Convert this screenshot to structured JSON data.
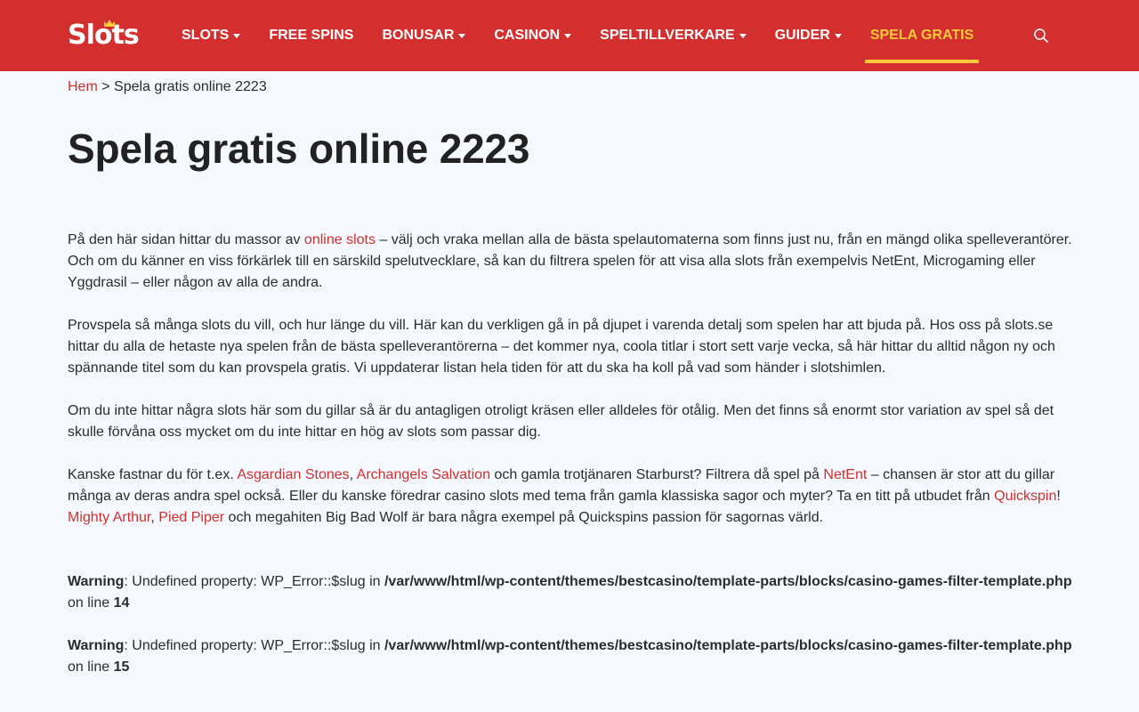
{
  "header": {
    "logo_text": "Slots",
    "nav": [
      {
        "label": "SLOTS",
        "dropdown": true
      },
      {
        "label": "FREE SPINS",
        "dropdown": false
      },
      {
        "label": "BONUSAR",
        "dropdown": true
      },
      {
        "label": "CASINON",
        "dropdown": true
      },
      {
        "label": "SPELTILLVERKARE",
        "dropdown": true
      },
      {
        "label": "GUIDER",
        "dropdown": true
      },
      {
        "label": "SPELA GRATIS",
        "dropdown": false,
        "active": true
      }
    ],
    "search_icon": "search-icon",
    "colors": {
      "brand": "#d32f2f",
      "accent": "#ffc83d"
    }
  },
  "breadcrumb": {
    "home": "Hem",
    "separator": ">",
    "current": "Spela gratis online 2223"
  },
  "page_title": "Spela gratis online 2223",
  "content": {
    "p1": {
      "t1": "På den här sidan hittar du massor av ",
      "link1": "online slots",
      "t2": " – välj och vraka mellan alla de bästa spelautomaterna som finns just nu, från en mängd olika spelleverantörer. Och om du känner en viss förkärlek till en särskild spelutvecklare, så kan du filtrera spelen för att visa alla slots från exempelvis NetEnt, Microgaming eller Yggdrasil – eller någon av alla de andra."
    },
    "p2": "Provspela så många slots du vill, och hur länge du vill. Här kan du verkligen gå in på djupet i varenda detalj som spelen har att bjuda på. Hos oss på slots.se hittar du alla de hetaste nya spelen från de bästa spelleverantörerna – det kommer nya, coola titlar i stort sett varje vecka, så här hittar du alltid någon ny och spännande titel som du kan provspela gratis. Vi uppdaterar listan hela tiden för att du ska ha koll på vad som händer i slotshimlen.",
    "p3": "Om du inte hittar några slots här som du gillar så är du antagligen otroligt kräsen eller alldeles för otålig. Men det finns så enormt stor variation av spel så det skulle förvåna oss mycket om du inte hittar en hög av slots som passar dig.",
    "p4": {
      "t1": "Kanske fastnar du för t.ex. ",
      "link1": "Asgardian Stones",
      "t2": ", ",
      "link2": "Archangels Salvation",
      "t3": " och gamla trotjänaren Starburst? Filtrera då spel på ",
      "link3": "NetEnt",
      "t4": " – chansen är stor att du gillar många av deras andra spel också. Eller du kanske föredrar casino slots med tema från gamla klassiska sagor och myter? Ta en titt på utbudet från ",
      "link4": "Quickspin",
      "t5": "! ",
      "link5": "Mighty Arthur",
      "t6": ", ",
      "link6": "Pied Piper",
      "t7": " och megahiten Big Bad Wolf är bara några exempel på Quickspins passion för sagornas värld."
    }
  },
  "warnings": [
    {
      "label": "Warning",
      "message": ": Undefined property: WP_Error::$slug in ",
      "path": "/var/www/html/wp-content/themes/bestcasino/template-parts/blocks/casino-games-filter-template.php",
      "on_line": " on line ",
      "line": "14"
    },
    {
      "label": "Warning",
      "message": ": Undefined property: WP_Error::$slug in ",
      "path": "/var/www/html/wp-content/themes/bestcasino/template-parts/blocks/casino-games-filter-template.php",
      "on_line": " on line ",
      "line": "15"
    }
  ]
}
